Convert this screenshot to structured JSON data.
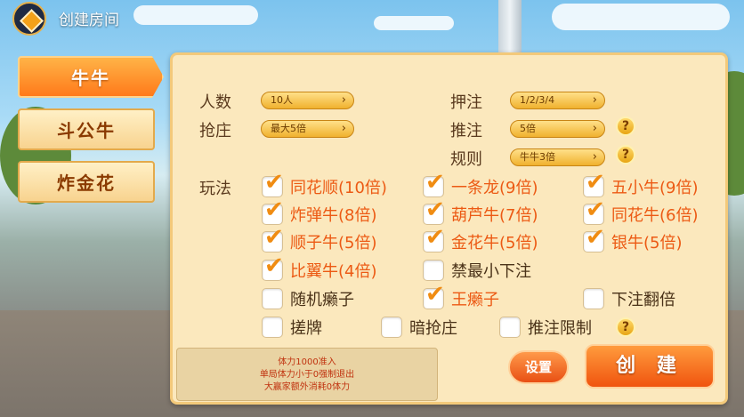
{
  "header": {
    "title": "创建房间"
  },
  "tabs": [
    {
      "label": "牛牛",
      "active": true
    },
    {
      "label": "斗公牛",
      "active": false
    },
    {
      "label": "炸金花",
      "active": false
    }
  ],
  "settings": {
    "players": {
      "label": "人数",
      "value": "10人"
    },
    "bet": {
      "label": "押注",
      "value": "1/2/3/4"
    },
    "banker": {
      "label": "抢庄",
      "value": "最大5倍"
    },
    "push": {
      "label": "推注",
      "value": "5倍"
    },
    "rule": {
      "label": "规则",
      "value": "牛牛3倍"
    },
    "modes_label": "玩法"
  },
  "options": [
    {
      "label": "同花顺(10倍)",
      "checked": true
    },
    {
      "label": "一条龙(9倍)",
      "checked": true
    },
    {
      "label": "五小牛(9倍)",
      "checked": true
    },
    {
      "label": "炸弹牛(8倍)",
      "checked": true
    },
    {
      "label": "葫芦牛(7倍)",
      "checked": true
    },
    {
      "label": "同花牛(6倍)",
      "checked": true
    },
    {
      "label": "顺子牛(5倍)",
      "checked": true
    },
    {
      "label": "金花牛(5倍)",
      "checked": true
    },
    {
      "label": "银牛(5倍)",
      "checked": true
    },
    {
      "label": "比翼牛(4倍)",
      "checked": true
    },
    {
      "label": "禁最小下注",
      "checked": false
    },
    {
      "label": "随机癞子",
      "checked": false
    },
    {
      "label": "王癞子",
      "checked": true
    },
    {
      "label": "下注翻倍",
      "checked": false
    },
    {
      "label": "搓牌",
      "checked": false
    },
    {
      "label": "暗抢庄",
      "checked": false
    },
    {
      "label": "推注限制",
      "checked": false
    }
  ],
  "note": {
    "line1": "体力1000准入",
    "line2": "单局体力小于0强制退出",
    "line3": "大赢家额外消耗0体力"
  },
  "buttons": {
    "settings": "设置",
    "create": "创 建"
  },
  "icons": {
    "help": "?",
    "chevron": "›",
    "check": "✔"
  },
  "colors": {
    "accent": "#f07a1a",
    "checked_text": "#ec5a14",
    "panel": "#fbe8bd"
  }
}
